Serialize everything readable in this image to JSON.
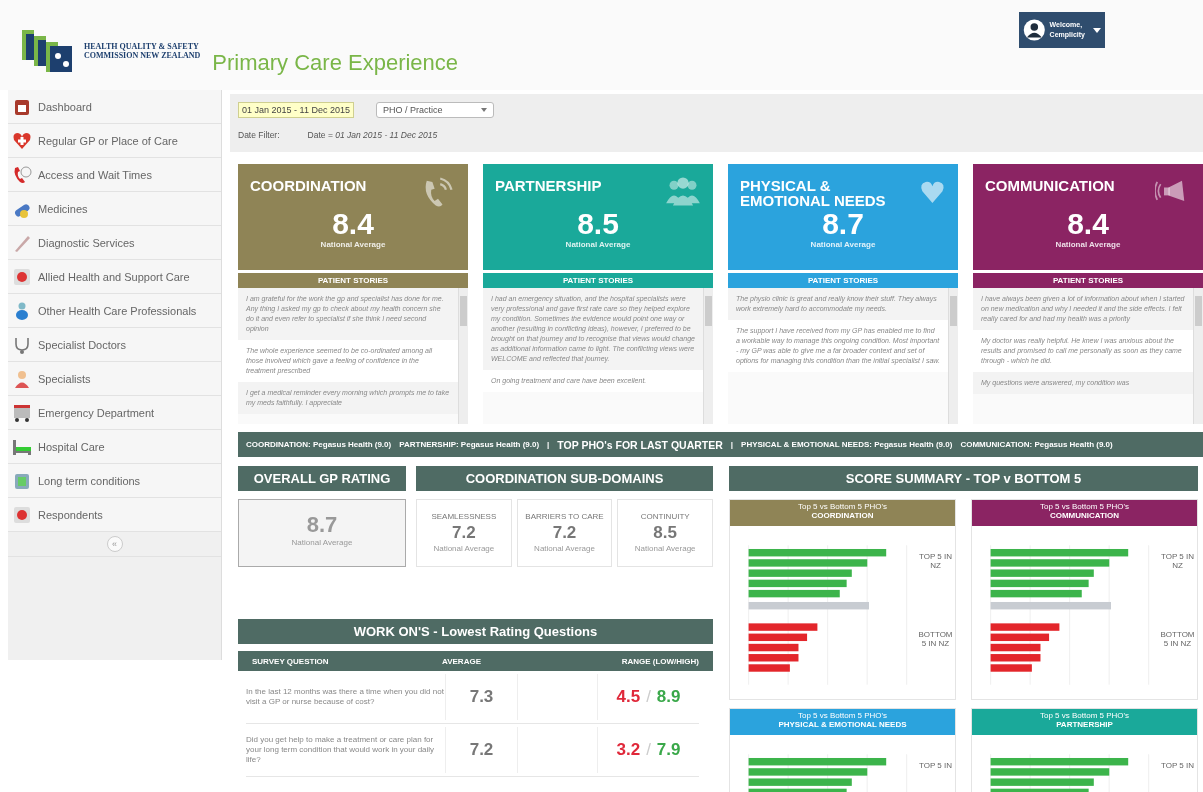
{
  "header": {
    "logo_lines": [
      "HEALTH QUALITY & SAFETY",
      "COMMISSION NEW ZEALAND"
    ],
    "title": "Primary Care Experience",
    "user": {
      "greeting": "Welcome,",
      "name": "Cemplicity"
    }
  },
  "sidebar": {
    "items": [
      {
        "label": "Dashboard"
      },
      {
        "label": "Regular GP or Place of Care"
      },
      {
        "label": "Access and Wait Times"
      },
      {
        "label": "Medicines"
      },
      {
        "label": "Diagnostic Services"
      },
      {
        "label": "Allied Health and Support Care"
      },
      {
        "label": "Other Health Care Professionals"
      },
      {
        "label": "Specialist Doctors"
      },
      {
        "label": "Specialists"
      },
      {
        "label": "Emergency Department"
      },
      {
        "label": "Hospital Care"
      },
      {
        "label": "Long term conditions"
      },
      {
        "label": "Respondents"
      }
    ],
    "collapse": "«"
  },
  "filters": {
    "date_range": "01 Jan 2015 - 11 Dec 2015",
    "pho_select": "PHO / Practice",
    "date_filter_label": "Date Filter:",
    "date_filter_value": "Date = *01 Jan 2015 - 11 Dec 2015*"
  },
  "domains": [
    {
      "title": "COORDINATION",
      "score": "8.4",
      "caption": "National Average",
      "stories_title": "PATIENT STORIES",
      "color": "#8f8456",
      "stories": [
        "I am grateful for the work the gp and specialist has done for me. Any thing I asked my gp to check about my health concern she do it and even refer to specialist if she think I need second opinion",
        "The whole experience seemed to be co-ordinated among all those involved which gave a feeling of confidence in the treatment prescribed",
        "I get a medical reminder every morning which prompts me to take my meds faithfully. I appreciate"
      ]
    },
    {
      "title": "PARTNERSHIP",
      "score": "8.5",
      "caption": "National Average",
      "stories_title": "PATIENT STORIES",
      "color": "#1aa99a",
      "stories": [
        "I had an emergency situation, and the hospital specialists were very professional and gave first rate care so they helped explore my condition. Sometimes the evidence would point one way or another (resulting in conflicting ideas), however, I preferred to be brought on that journey and to recognise that views would change as additional information came to light. The conflicting views were WELCOME and reflected that journey.",
        "On going treatment and care have been excellent."
      ]
    },
    {
      "title": "PHYSICAL & EMOTIONAL NEEDS",
      "score": "8.7",
      "caption": "National Average",
      "stories_title": "PATIENT STORIES",
      "color": "#2ba3dd",
      "stories": [
        "The physio clinic is great and really know their stuff. They always work extremely hard to accommodate my needs.",
        "The support I have received from my GP has enabled me to find a workable way to manage this ongoing condition. Most important - my GP was able to give me a far broader context and set of options for managing this condition than the initial specialist I saw."
      ]
    },
    {
      "title": "COMMUNICATION",
      "score": "8.4",
      "caption": "National Average",
      "stories_title": "PATIENT STORIES",
      "color": "#8b2463",
      "stories": [
        "I have always been given a lot of information about when I started on new medication and why I needed it and the side effects. I felt really cared for and had my health was a priority",
        "My doctor was really helpful. He knew I was anxious about the results and promised to call me personally as soon as they came through - which he did.",
        "My questions were answered, my condition was"
      ]
    }
  ],
  "ticker": [
    "COORDINATION: Pegasus Health (9.0)",
    "PARTNERSHIP: Pegasus Health (9.0)",
    "|",
    "TOP PHO's FOR LAST QUARTER",
    "|",
    "PHYSICAL & EMOTIONAL NEEDS: Pegasus Health (9.0)",
    "COMMUNICATION: Pegasus Health (9.0)"
  ],
  "overall": {
    "title": "OVERALL GP RATING",
    "score": "8.7",
    "caption": "National Average"
  },
  "sub_domains": {
    "title": "COORDINATION SUB-DOMAINS",
    "items": [
      {
        "label": "SEAMLESSNESS",
        "score": "7.2",
        "caption": "National Average"
      },
      {
        "label": "BARRIERS TO CARE",
        "score": "7.2",
        "caption": "National Average"
      },
      {
        "label": "CONTINUITY",
        "score": "8.5",
        "caption": "National Average"
      }
    ]
  },
  "work_ons": {
    "title": "WORK ON'S - Lowest Rating Questions",
    "columns": [
      "SURVEY QUESTION",
      "AVERAGE",
      "RANGE (LOW/HIGH)"
    ],
    "range_separator": "/",
    "rows": [
      {
        "question": "In the last 12 months was there a time when you did not visit a GP or nurse because of cost?",
        "average": "7.3",
        "low": "4.5",
        "high": "8.9"
      },
      {
        "question": "Did you get help to make a treatment or care plan for your long term condition that would work in your daily life?",
        "average": "7.2",
        "low": "3.2",
        "high": "7.9"
      }
    ]
  },
  "score_summary": {
    "title": "SCORE SUMMARY - TOP v BOTTOM 5",
    "charts": [
      {
        "title": "Top 5 vs Bottom 5 PHO's",
        "subtitle": "COORDINATION",
        "color": "#8f8456",
        "top_label": "TOP 5 IN NZ",
        "bottom_label": "BOTTOM 5 IN NZ"
      },
      {
        "title": "Top 5 vs Bottom 5 PHO's",
        "subtitle": "COMMUNICATION",
        "color": "#8b2463",
        "top_label": "TOP 5 IN NZ",
        "bottom_label": "BOTTOM 5 IN NZ"
      },
      {
        "title": "Top 5 vs Bottom 5 PHO's",
        "subtitle": "PHYSICAL & EMOTIONAL NEEDS",
        "color": "#2ba3dd",
        "top_label": "TOP 5 IN"
      },
      {
        "title": "Top 5 vs Bottom 5 PHO's",
        "subtitle": "PARTNERSHIP",
        "color": "#1aa99a",
        "top_label": "TOP 5 IN"
      }
    ]
  }
}
